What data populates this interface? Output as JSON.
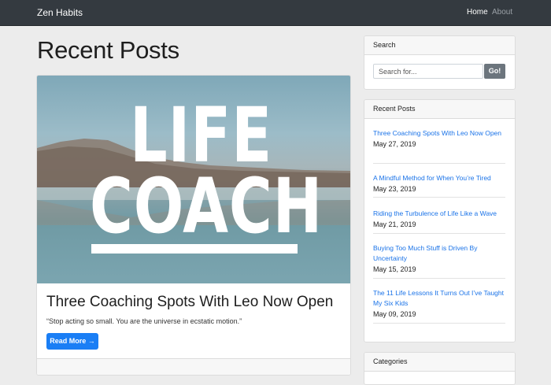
{
  "navbar": {
    "brand": "Zen Habits",
    "links": [
      {
        "label": "Home",
        "active": true
      },
      {
        "label": "About",
        "active": false
      }
    ]
  },
  "main": {
    "heading": "Recent Posts",
    "post": {
      "image_text_line1": "LIFE",
      "image_text_line2": "COACH",
      "title": "Three Coaching Spots With Leo Now Open",
      "excerpt": "“Stop acting so small. You are the universe in ecstatic motion.”",
      "read_more_label": "Read More →"
    }
  },
  "sidebar": {
    "search": {
      "header": "Search",
      "placeholder": "Search for...",
      "button_label": "Go!"
    },
    "recent_posts": {
      "header": "Recent Posts",
      "items": [
        {
          "title": "Three Coaching Spots With Leo Now Open",
          "date": "May 27, 2019"
        },
        {
          "title": "A Mindful Method for When You’re Tired",
          "date": "May 23, 2019"
        },
        {
          "title": "Riding the Turbulence of Life Like a Wave",
          "date": "May 21, 2019"
        },
        {
          "title": "Buying Too Much Stuff is Driven By Uncertainty",
          "date": "May 15, 2019"
        },
        {
          "title": "The 11 Life Lessons It Turns Out I’ve Taught My Six Kids",
          "date": "May 09, 2019"
        }
      ]
    },
    "categories": {
      "header": "Categories"
    }
  },
  "colors": {
    "navbar_bg": "#343a40",
    "primary_button": "#1a7ef5",
    "secondary_button": "#6c757d",
    "link": "#1a73e8",
    "page_bg": "#ececec"
  }
}
